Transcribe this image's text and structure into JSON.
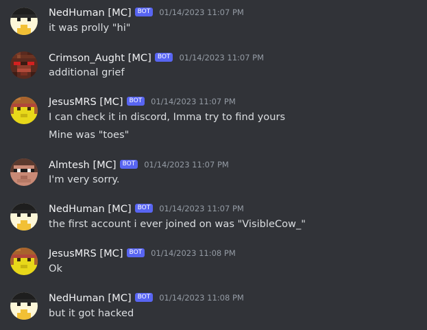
{
  "bot_tag": "BOT",
  "colors": {
    "background": "#313338",
    "username": "#f2f3f5",
    "text": "#dbdee1",
    "timestamp": "#949ba4",
    "bot_tag": "#5865f2"
  },
  "messages": [
    {
      "author": "NedHuman [MC]",
      "avatar": "nedhuman-avatar",
      "timestamp": "01/14/2023 11:07 PM",
      "lines": [
        "it was prolly \"hi\""
      ]
    },
    {
      "author": "Crimson_Aught [MC]",
      "avatar": "crimson-aught-avatar",
      "timestamp": "01/14/2023 11:07 PM",
      "lines": [
        "additional grief"
      ]
    },
    {
      "author": "JesusMRS [MC]",
      "avatar": "jesusmrs-avatar",
      "timestamp": "01/14/2023 11:07 PM",
      "lines": [
        "I can check it in discord, Imma try to find yours",
        "Mine was \"toes\""
      ]
    },
    {
      "author": "Almtesh [MC]",
      "avatar": "almtesh-avatar",
      "timestamp": "01/14/2023 11:07 PM",
      "lines": [
        "I'm very sorry."
      ]
    },
    {
      "author": "NedHuman [MC]",
      "avatar": "nedhuman-avatar",
      "timestamp": "01/14/2023 11:07 PM",
      "lines": [
        "the first account i ever joined on was \"VisibleCow_\""
      ]
    },
    {
      "author": "JesusMRS [MC]",
      "avatar": "jesusmrs-avatar",
      "timestamp": "01/14/2023 11:08 PM",
      "lines": [
        "Ok"
      ]
    },
    {
      "author": "NedHuman [MC]",
      "avatar": "nedhuman-avatar",
      "timestamp": "01/14/2023 11:08 PM",
      "lines": [
        "but it got hacked"
      ]
    }
  ]
}
